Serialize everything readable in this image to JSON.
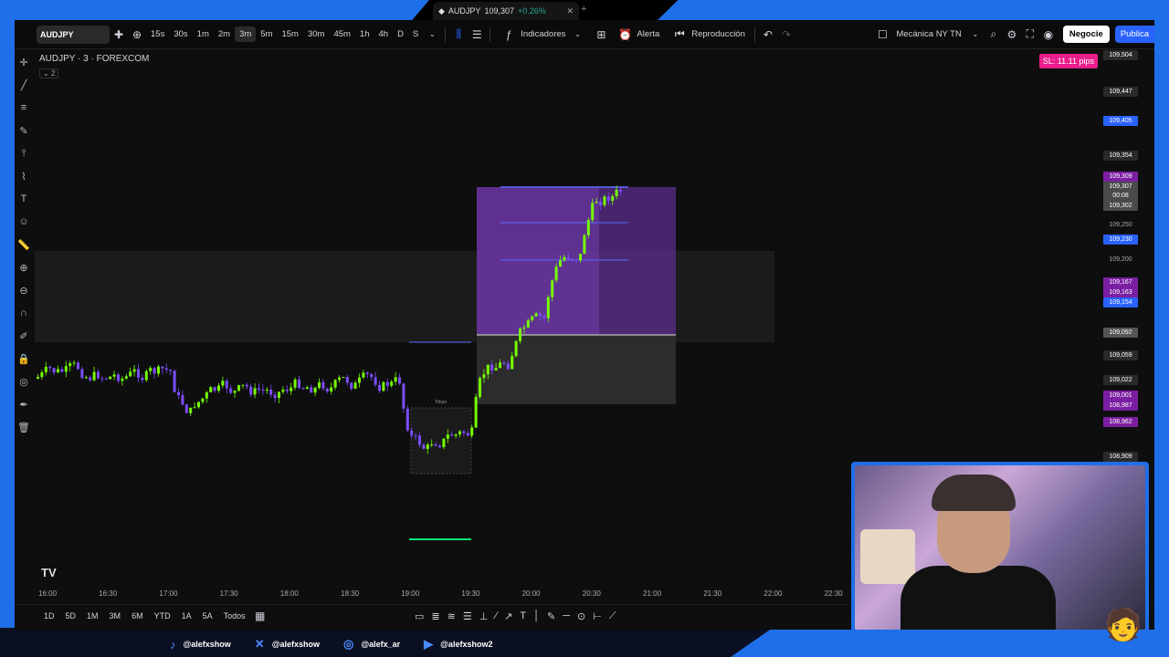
{
  "browser": {
    "tab_title": "AUDJPY",
    "tab_price": "109,307",
    "tab_change": "+0.26%"
  },
  "toolbar": {
    "symbol": "AUDJPY",
    "intervals": [
      "15s",
      "30s",
      "1m",
      "2m",
      "3m",
      "5m",
      "15m",
      "30m",
      "45m",
      "1h",
      "4h",
      "D",
      "S"
    ],
    "active_interval": "3m",
    "indicators_label": "Indicadores",
    "alert_label": "Alerta",
    "replay_label": "Reproducción",
    "layout_name": "Mecánica NY TN",
    "trade_label": "Negocie",
    "publish_label": "Publica"
  },
  "chart": {
    "title": "AUDJPY · 3 · FOREXCOM",
    "sub_count": "2",
    "sl_badge": "SL: 11.11 pips",
    "session_label": "Tokyo",
    "tv_logo": "TV"
  },
  "price_axis": [
    {
      "label": "109,504",
      "bg": "#2a2a2a"
    },
    {
      "label": "109,447",
      "bg": "#2a2a2a"
    },
    {
      "label": "109,405",
      "bg": "#2962ff"
    },
    {
      "label": "109,354",
      "bg": "#2a2a2a"
    },
    {
      "label": "109,309",
      "bg": "#7b1fa2"
    },
    {
      "label": "109,307",
      "bg": "#4a4a4a"
    },
    {
      "label": "00:08",
      "bg": "#4a4a4a"
    },
    {
      "label": "109,302",
      "bg": "#4a4a4a"
    },
    {
      "label": "109,250",
      "bg": ""
    },
    {
      "label": "109,230",
      "bg": "#2962ff"
    },
    {
      "label": "109,200",
      "bg": ""
    },
    {
      "label": "109,167",
      "bg": "#7b1fa2"
    },
    {
      "label": "109,163",
      "bg": "#7b1fa2"
    },
    {
      "label": "109,154",
      "bg": "#2962ff"
    },
    {
      "label": "109,092",
      "bg": "#555555"
    },
    {
      "label": "109,059",
      "bg": "#2a2a2a"
    },
    {
      "label": "109,022",
      "bg": "#2a2a2a"
    },
    {
      "label": "109,001",
      "bg": "#7b1fa2"
    },
    {
      "label": "108,987",
      "bg": "#7b1fa2"
    },
    {
      "label": "108,962",
      "bg": "#7b1fa2"
    },
    {
      "label": "108,909",
      "bg": "#2a2a2a"
    }
  ],
  "time_axis": [
    "16:00",
    "16:30",
    "17:00",
    "17:30",
    "18:00",
    "18:30",
    "19:00",
    "19:30",
    "20:00",
    "20:30",
    "21:00",
    "21:30",
    "22:00",
    "22:30"
  ],
  "ranges": [
    "1D",
    "5D",
    "1M",
    "3M",
    "6M",
    "YTD",
    "1A",
    "5A",
    "Todos"
  ],
  "socials": [
    {
      "icon": "tiktok-icon",
      "handle": "@alefxshow"
    },
    {
      "icon": "x-icon",
      "handle": "@alefxshow"
    },
    {
      "icon": "instagram-icon",
      "handle": "@alefx_ar"
    },
    {
      "icon": "youtube-icon",
      "handle": "@alefxshow2"
    }
  ]
}
